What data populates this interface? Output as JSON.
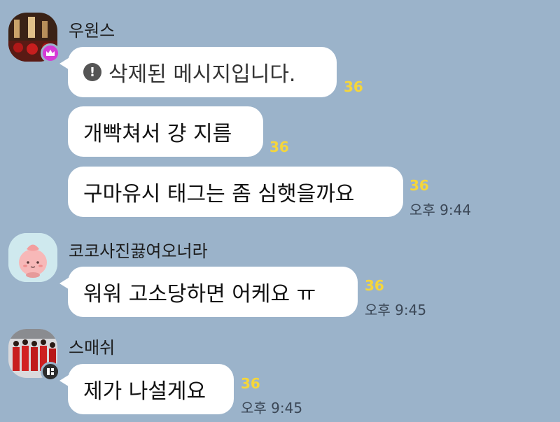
{
  "chat": {
    "groups": [
      {
        "sender": "우원스",
        "messages": [
          {
            "text": "삭제된 메시지입니다.",
            "unread": "36",
            "deleted": true
          },
          {
            "text": "개빡쳐서 걍 지름",
            "unread": "36"
          },
          {
            "text": "구마유시 태그는 좀 심햇을까요",
            "unread": "36",
            "time": "오후 9:44"
          }
        ]
      },
      {
        "sender": "코코사진끓여오너라",
        "messages": [
          {
            "text": "워워 고소당하면 어케요 ㅠ",
            "unread": "36",
            "time": "오후 9:45"
          }
        ]
      },
      {
        "sender": "스매쉬",
        "messages": [
          {
            "text": "제가 나설게요",
            "unread": "36",
            "time": "오후 9:45"
          }
        ]
      }
    ]
  },
  "colors": {
    "background": "#9bb3ca",
    "bubble": "#ffffff",
    "unread": "#f5d63b",
    "crown_badge": "#d63bd6"
  },
  "icons": [
    "crown-icon",
    "exclamation-icon",
    "grid-icon"
  ]
}
